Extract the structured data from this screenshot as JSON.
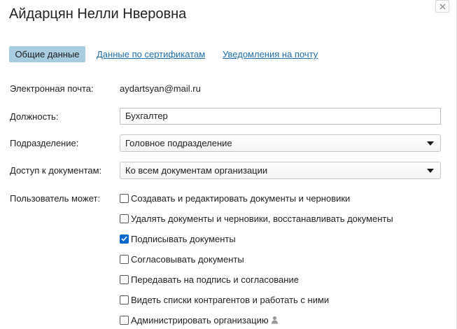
{
  "dialog": {
    "title": "Айдарцян Нелли Нверовна",
    "close_icon": "close-icon"
  },
  "tabs": [
    {
      "label": "Общие данные",
      "active": true
    },
    {
      "label": "Данные по сертификатам",
      "active": false
    },
    {
      "label": "Уведомления на почту",
      "active": false
    }
  ],
  "form": {
    "email": {
      "label": "Электронная почта:",
      "value": "aydartsyan@mail.ru"
    },
    "position": {
      "label": "Должность:",
      "value": "Бухгалтер"
    },
    "department": {
      "label": "Подразделение:",
      "value": "Головное подразделение"
    },
    "access": {
      "label": "Доступ к документам:",
      "value": "Ко всем документам организации"
    },
    "permissions_label": "Пользователь может:"
  },
  "permissions": [
    {
      "label": "Создавать и редактировать документы и черновики",
      "checked": false
    },
    {
      "label": "Удалять документы и черновики, восстанавливать документы",
      "checked": false
    },
    {
      "label": "Подписывать документы",
      "checked": true
    },
    {
      "label": "Согласовывать документы",
      "checked": false
    },
    {
      "label": "Передавать на подпись и согласование",
      "checked": false
    },
    {
      "label": "Видеть списки контрагентов и работать с ними",
      "checked": false
    },
    {
      "label": "Администрировать организацию",
      "checked": false,
      "icon": "user-admin-icon"
    }
  ],
  "colors": {
    "active_tab_bg": "#a8cde1",
    "link": "#1f6fb0",
    "checkbox_checked": "#0b67d0"
  }
}
